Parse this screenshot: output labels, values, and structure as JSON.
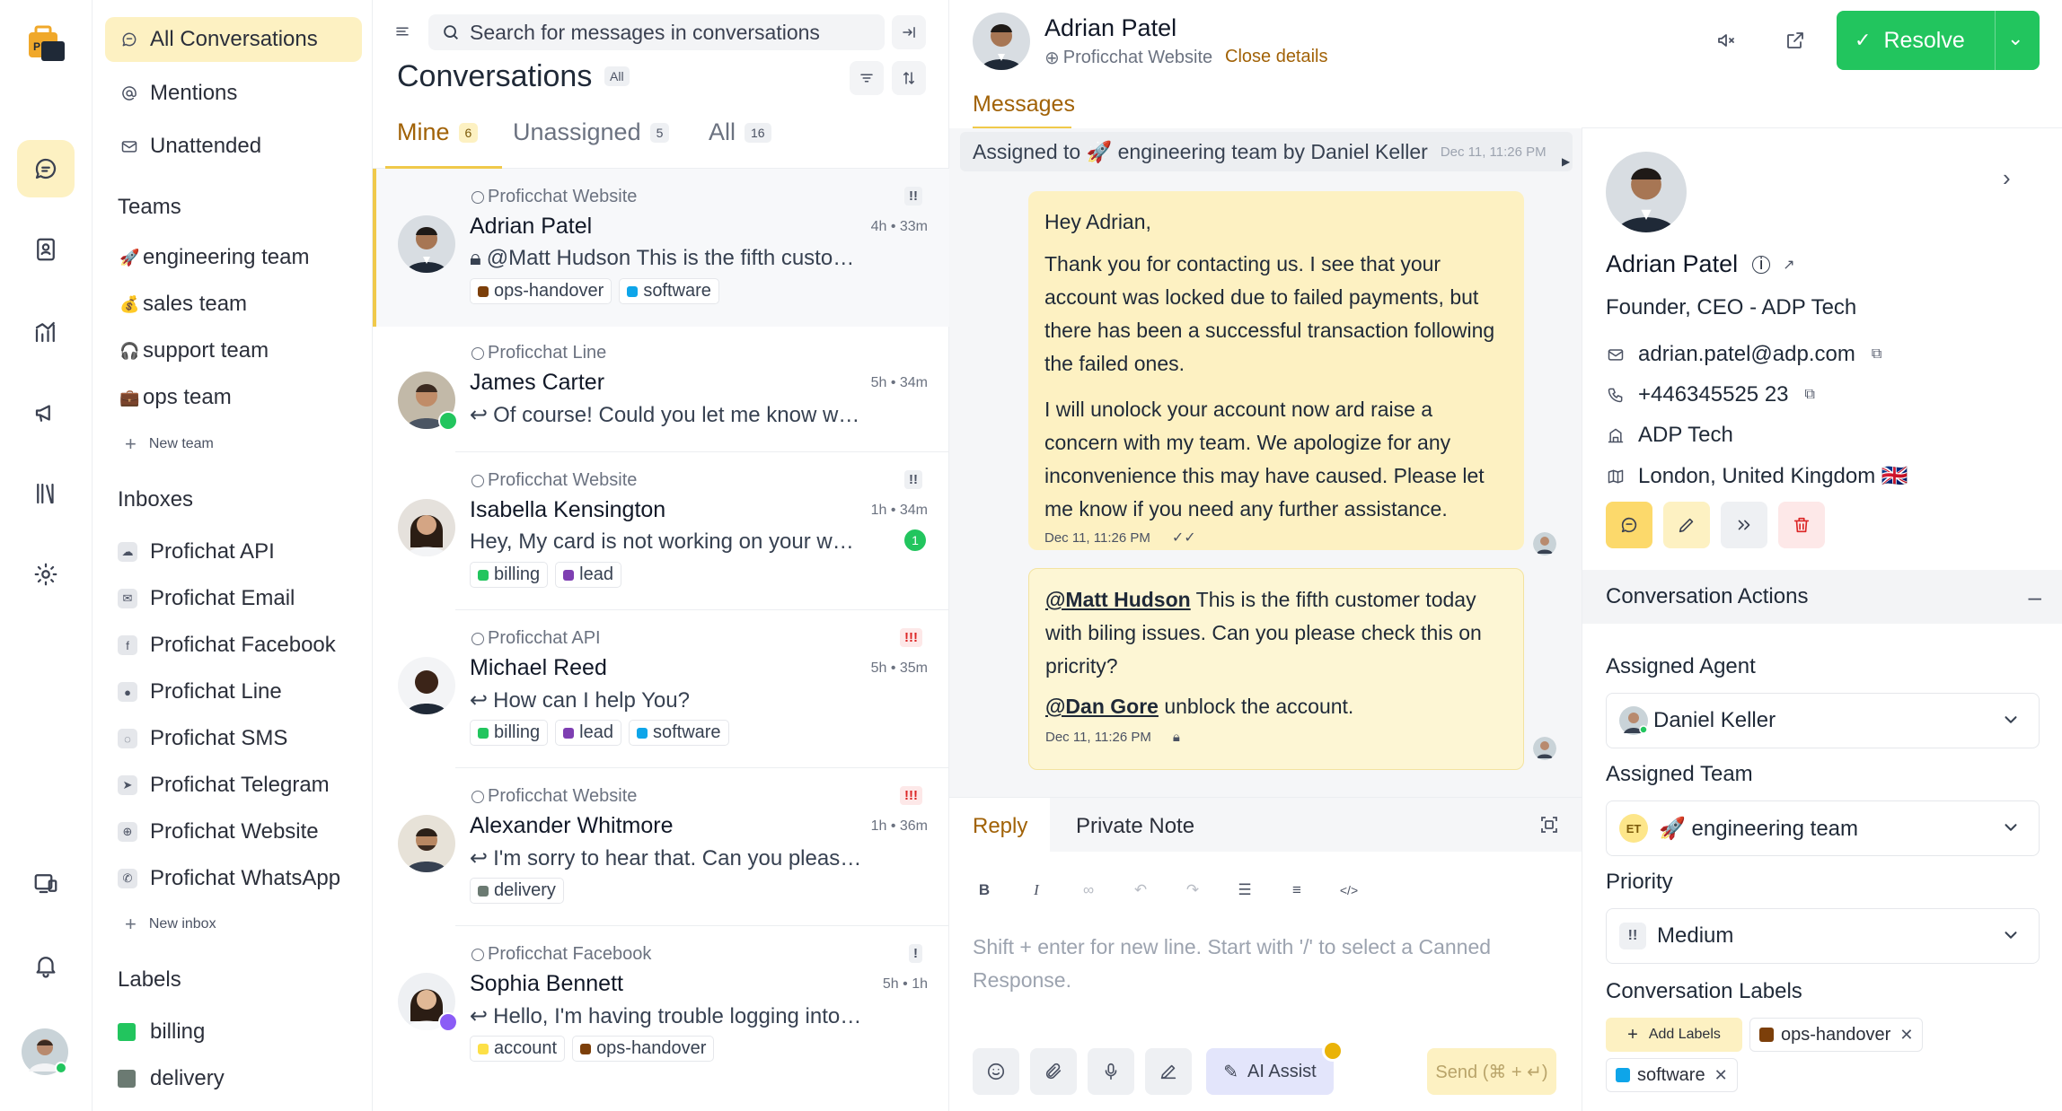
{
  "colors": {
    "accent": "#f0c94a",
    "accent_soft": "#fdf1c2",
    "resolve": "#22c55e",
    "urgent": "#dc2626"
  },
  "sidebar": {
    "nav": [
      {
        "label": "All Conversations",
        "icon": "chat-icon"
      },
      {
        "label": "Mentions",
        "icon": "at-icon"
      },
      {
        "label": "Unattended",
        "icon": "mail-icon"
      }
    ],
    "teams_title": "Teams",
    "teams": [
      {
        "emoji": "🚀",
        "label": "engineering team"
      },
      {
        "emoji": "💰",
        "label": "sales team"
      },
      {
        "emoji": "🎧",
        "label": "support team"
      },
      {
        "emoji": "💼",
        "label": "ops team"
      }
    ],
    "new_team": "New team",
    "inboxes_title": "Inboxes",
    "inboxes": [
      {
        "label": "Profichat API",
        "icon": "cloud-icon"
      },
      {
        "label": "Profichat Email",
        "icon": "email-icon"
      },
      {
        "label": "Profichat Facebook",
        "icon": "facebook-icon"
      },
      {
        "label": "Profichat Line",
        "icon": "line-icon"
      },
      {
        "label": "Profichat SMS",
        "icon": "sms-icon"
      },
      {
        "label": "Profichat Telegram",
        "icon": "telegram-icon"
      },
      {
        "label": "Profichat Website",
        "icon": "globe-icon"
      },
      {
        "label": "Profichat WhatsApp",
        "icon": "whatsapp-icon"
      }
    ],
    "new_inbox": "New inbox",
    "labels_title": "Labels",
    "labels": [
      {
        "label": "billing",
        "color": "#22c55e"
      },
      {
        "label": "delivery",
        "color": "#6b7a72"
      }
    ]
  },
  "convlist": {
    "search_placeholder": "Search for messages in conversations",
    "title": "Conversations",
    "status_badge": "All",
    "tabs": [
      {
        "label": "Mine",
        "count": "6"
      },
      {
        "label": "Unassigned",
        "count": "5"
      },
      {
        "label": "All",
        "count": "16"
      }
    ],
    "items": [
      {
        "inbox": "Proficchat Website",
        "name": "Adrian Patel",
        "time": "4h • 33m",
        "message": "@Matt Hudson This is the fifth customer today with biling issues.",
        "prio": "!!",
        "labels": [
          {
            "label": "ops-handover",
            "color": "#7c3f0a"
          },
          {
            "label": "software",
            "color": "#0ea5e9"
          }
        ]
      },
      {
        "inbox": "Proficchat Line",
        "name": "James Carter",
        "time": "5h • 34m",
        "message": "Of course! Could you let me know what issue you're facing?",
        "prio": "",
        "labels": []
      },
      {
        "inbox": "Proficchat Website",
        "name": "Isabella Kensington",
        "time": "1h • 34m",
        "message": "Hey, My card is not working on your website",
        "prio": "!!",
        "unread": "1",
        "labels": [
          {
            "label": "billing",
            "color": "#22c55e"
          },
          {
            "label": "lead",
            "color": "#7e3fb2"
          }
        ]
      },
      {
        "inbox": "Proficchat API",
        "name": "Michael Reed",
        "time": "5h • 35m",
        "message": "How can I help You?",
        "prio": "!!!",
        "labels": [
          {
            "label": "billing",
            "color": "#22c55e"
          },
          {
            "label": "lead",
            "color": "#7e3fb2"
          },
          {
            "label": "software",
            "color": "#0ea5e9"
          }
        ]
      },
      {
        "inbox": "Proficchat Website",
        "name": "Alexander Whitmore",
        "time": "1h • 36m",
        "message": "I'm sorry to hear that. Can you please share your order number?",
        "prio": "!!!",
        "labels": [
          {
            "label": "delivery",
            "color": "#6b7a72"
          }
        ]
      },
      {
        "inbox": "Proficchat Facebook",
        "name": "Sophia Bennett",
        "time": "5h • 1h",
        "message": "Hello, I'm having trouble logging into my account.",
        "prio": "!",
        "labels": [
          {
            "label": "account",
            "color": "#fde047"
          },
          {
            "label": "ops-handover",
            "color": "#7c3f0a"
          }
        ]
      }
    ]
  },
  "chat": {
    "name": "Adrian Patel",
    "inbox": "Proficchat Website",
    "close_details": "Close details",
    "messages_tab": "Messages",
    "activity": "Assigned to 🚀 engineering team by Daniel Keller",
    "activity_time": "Dec 11, 11:26 PM",
    "bubble1": {
      "p1": "Hey Adrian,",
      "p2": "Thank you for contacting us. I see that your account was locked due to failed payments, but there has been a successful transaction following the failed ones.",
      "p3": "I will unolock your account now ard raise a concern with my team. We apologize for any inconvenience this may have caused. Please let me know if you need any further assistance.",
      "time": "Dec 11, 11:26 PM"
    },
    "bubble2": {
      "mention1": "@Matt Hudson",
      "text1": " This is the fifth customer today with biling issues. Can you please check this on pricrity?",
      "mention2": "@Dan Gore",
      "text2": " unblock the account.",
      "time": "Dec 11, 11:26 PM"
    },
    "composer": {
      "reply_tab": "Reply",
      "private_tab": "Private Note",
      "placeholder": "Shift + enter for new line. Start with '/' to select a Canned Response.",
      "ai_assist": "AI Assist",
      "send": "Send (⌘ + ↵)"
    }
  },
  "header": {
    "resolve": "Resolve"
  },
  "details": {
    "name": "Adrian Patel",
    "title": "Founder, CEO - ADP Tech",
    "email": "adrian.patel@adp.com",
    "phone": "+446345525 23",
    "company": "ADP Tech",
    "location": "London, United Kingdom 🇬🇧",
    "actions_title": "Conversation Actions",
    "assigned_agent_label": "Assigned Agent",
    "assigned_agent": "Daniel Keller",
    "assigned_team_label": "Assigned Team",
    "assigned_team": "🚀 engineering team",
    "team_initials": "ET",
    "priority_label": "Priority",
    "priority": "Medium",
    "priority_icon": "!!",
    "labels_title": "Conversation Labels",
    "add_labels": "Add Labels",
    "labels": [
      {
        "label": "ops-handover",
        "color": "#7c3f0a"
      },
      {
        "label": "software",
        "color": "#0ea5e9"
      }
    ]
  }
}
